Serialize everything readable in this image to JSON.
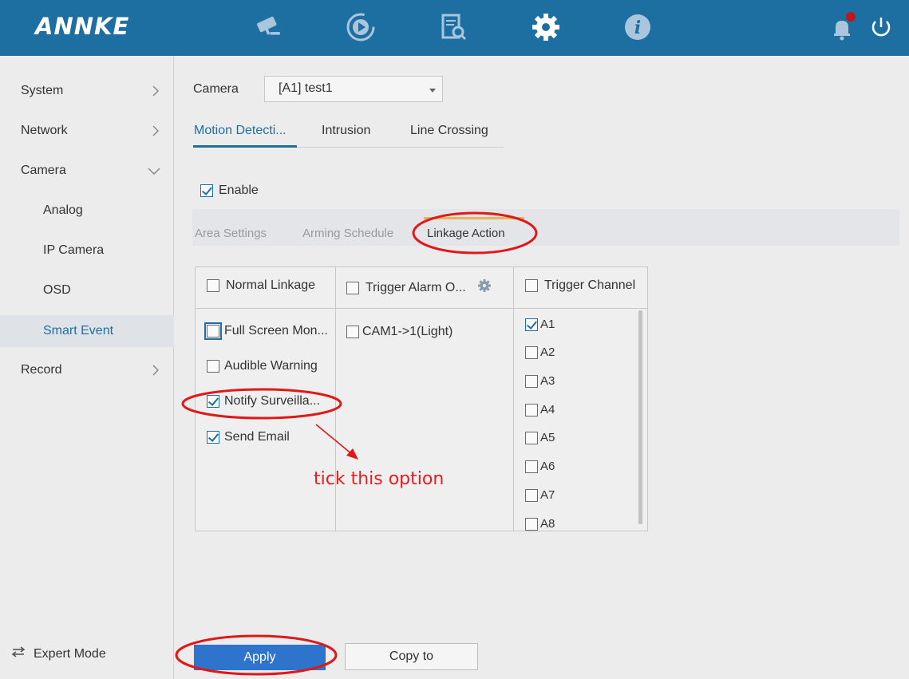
{
  "app": {
    "brand": "ANNKE",
    "nav_icons": [
      "camera-icon",
      "playback-icon",
      "search-file-icon",
      "settings-gear-icon",
      "info-icon"
    ],
    "right_icons": [
      "notification-bell-icon",
      "power-icon"
    ],
    "colors": {
      "topbar": "#1e6fa1",
      "accent": "#1e6fa1",
      "apply": "#2e73cc",
      "annotation": "#e02020"
    }
  },
  "sidebar": {
    "items": [
      {
        "label": "System"
      },
      {
        "label": "Network"
      },
      {
        "label": "Camera"
      },
      {
        "label": "Analog"
      },
      {
        "label": "IP Camera"
      },
      {
        "label": "OSD"
      },
      {
        "label": "Smart Event"
      },
      {
        "label": "Record"
      }
    ],
    "expert_mode": "Expert Mode"
  },
  "main": {
    "camera_label": "Camera",
    "camera_value": "[A1] test1",
    "tabs": [
      {
        "label": "Motion Detecti..."
      },
      {
        "label": "Intrusion"
      },
      {
        "label": "Line Crossing"
      }
    ],
    "enable_label": "Enable",
    "enable_checked": true,
    "subtabs": [
      {
        "label": "Area Settings"
      },
      {
        "label": "Arming Schedule"
      },
      {
        "label": "Linkage Action"
      }
    ],
    "columns": [
      {
        "label": "Normal Linkage"
      },
      {
        "label": "Trigger Alarm O..."
      },
      {
        "label": "Trigger Channel"
      }
    ],
    "normal_linkage": [
      {
        "label": "Full Screen Mon...",
        "checked": false
      },
      {
        "label": "Audible Warning",
        "checked": false
      },
      {
        "label": "Notify Surveilla...",
        "checked": true
      },
      {
        "label": "Send Email",
        "checked": true
      }
    ],
    "alarm_outputs": [
      {
        "label": "CAM1->1(Light)",
        "checked": false
      }
    ],
    "channels": [
      {
        "label": "A1",
        "checked": true
      },
      {
        "label": "A2",
        "checked": false
      },
      {
        "label": "A3",
        "checked": false
      },
      {
        "label": "A4",
        "checked": false
      },
      {
        "label": "A5",
        "checked": false
      },
      {
        "label": "A6",
        "checked": false
      },
      {
        "label": "A7",
        "checked": false
      },
      {
        "label": "A8",
        "checked": false
      }
    ]
  },
  "annotation": {
    "text": "tick this option"
  },
  "buttons": {
    "apply": "Apply",
    "copy_to": "Copy to"
  }
}
